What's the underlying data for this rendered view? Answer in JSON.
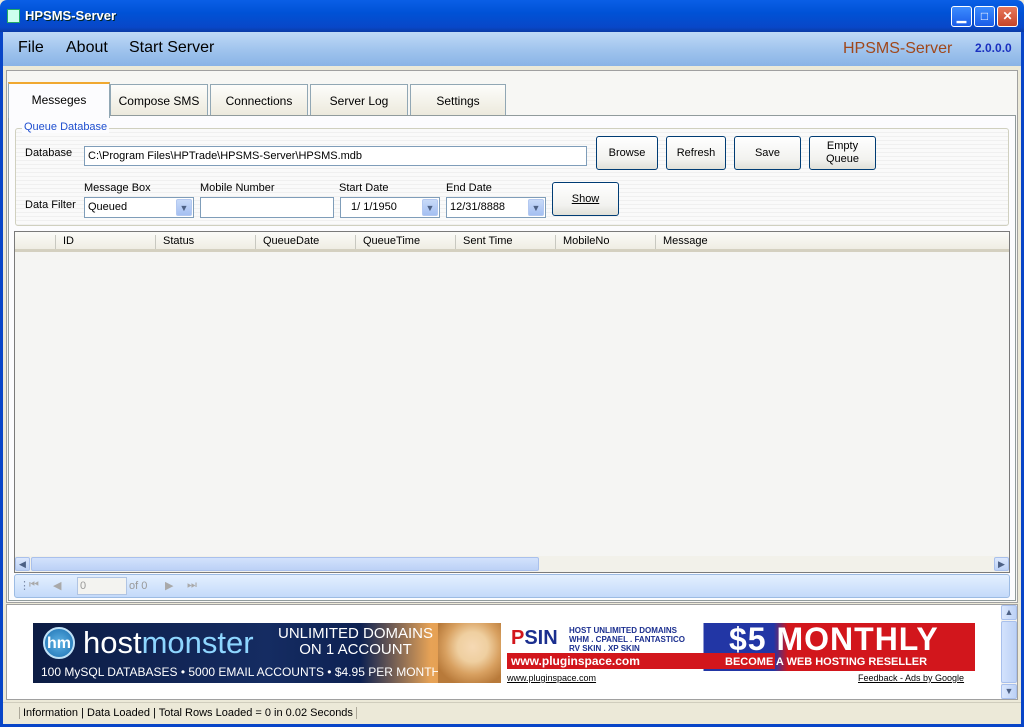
{
  "window": {
    "title": "HPSMS-Server"
  },
  "menu": {
    "file": "File",
    "about": "About",
    "start_server": "Start Server",
    "brand": "HPSMS-Server",
    "version": "2.0.0.0"
  },
  "tabs": [
    "Messeges",
    "Compose SMS",
    "Connections",
    "Server Log",
    "Settings"
  ],
  "queue_group": {
    "title": "Queue Database",
    "database_label": "Database",
    "database_path": "C:\\Program Files\\HPTrade\\HPSMS-Server\\HPSMS.mdb",
    "browse": "Browse",
    "refresh": "Refresh",
    "save": "Save",
    "empty_queue": "Empty Queue",
    "data_filter_label": "Data Filter",
    "message_box_label": "Message Box",
    "message_box_value": "Queued",
    "mobile_number_label": "Mobile Number",
    "mobile_number_value": "",
    "start_date_label": "Start Date",
    "start_date_value": "1/ 1/1950",
    "end_date_label": "End Date",
    "end_date_value": "12/31/8888",
    "show": "Show"
  },
  "grid": {
    "columns": [
      "ID",
      "Status",
      "QueueDate",
      "QueueTime",
      "Sent Time",
      "MobileNo",
      "Message"
    ],
    "rows": []
  },
  "navigator": {
    "position": "0",
    "of_label": "of 0"
  },
  "ads": {
    "hostmonster_logo": "hm",
    "hostmonster_host": "host",
    "hostmonster_monster": "monster",
    "hostmonster_line1": "UNLIMITED DOMAINS",
    "hostmonster_line2": "ON 1 ACCOUNT",
    "hostmonster_sub": "100 MySQL DATABASES • 5000 EMAIL ACCOUNTS • $4.95 PER MONTH",
    "plugin_logo_p": "P",
    "plugin_logo_rest": "SIN",
    "plugin_feat1": "HOST UNLIMITED DOMAINS",
    "plugin_feat2": "WHM . CPANEL . FANTASTICO",
    "plugin_feat3": "RV SKIN . XP SKIN",
    "plugin_url": "www.pluginspace.com",
    "plugin_price": "$5 MONTHLY",
    "plugin_tagline": "BECOME A WEB HOSTING RESELLER",
    "link_left": "www.pluginspace.com",
    "link_right": "Feedback - Ads by Google"
  },
  "status": {
    "text": "Information | Data Loaded | Total Rows Loaded = 0  in  0.02 Seconds"
  }
}
